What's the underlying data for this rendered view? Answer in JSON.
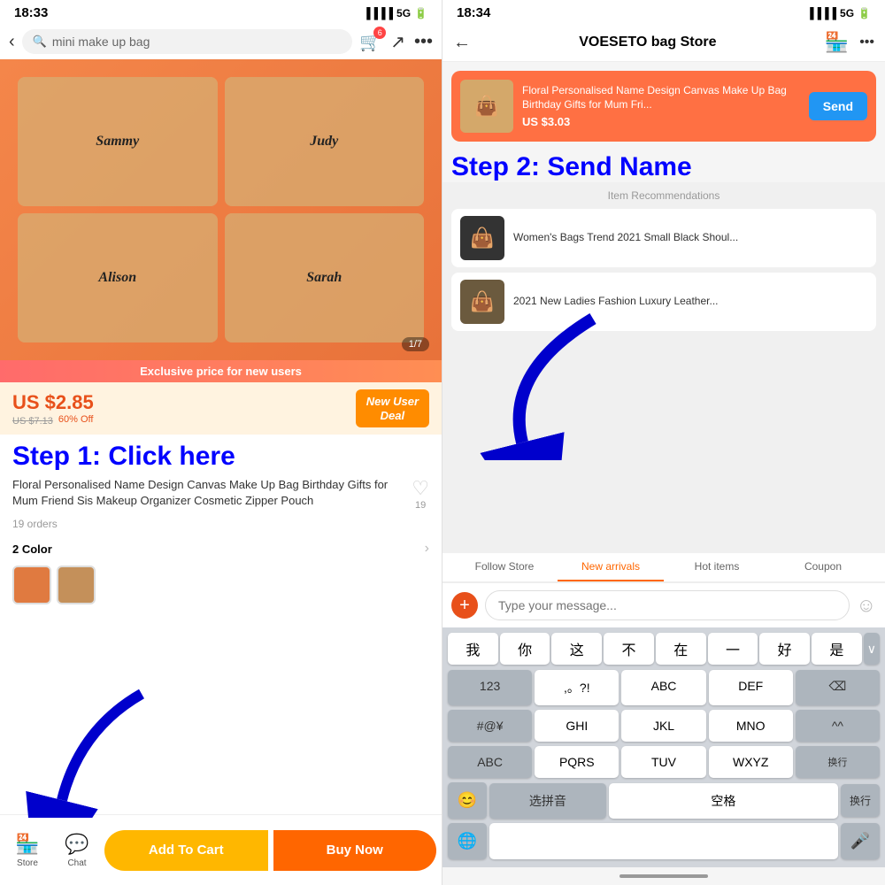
{
  "left": {
    "statusBar": {
      "time": "18:33",
      "network": "5G"
    },
    "searchPlaceholder": "mini make up bag",
    "cartCount": "6",
    "imageCounter": "1/7",
    "exclusiveBanner": "Exclusive price for new users",
    "price": {
      "current": "US $2.85",
      "original": "US $7.13",
      "discount": "60% Off"
    },
    "newUserDeal": "New User\nDeal",
    "step1Label": "Step 1: Click here",
    "productTitle": "Floral Personalised Name Design Canvas Make Up Bag Birthday Gifts for Mum Friend Sis Makeup Organizer Cosmetic Zipper Pouch",
    "wishlistCount": "19",
    "ordersCount": "19 orders",
    "colorSection": {
      "label": "2 Color"
    },
    "bottomNav": {
      "storeLabel": "Store",
      "chatLabel": "Chat",
      "addToCart": "Add To Cart",
      "buyNow": "Buy Now"
    },
    "bagNames": [
      "Sammy",
      "Judy",
      "Alison",
      "Sarah"
    ]
  },
  "right": {
    "statusBar": {
      "time": "18:34",
      "network": "5G"
    },
    "storeTitle": "VOESETO bag Store",
    "chatProduct": {
      "title": "Floral Personalised Name Design Canvas Make Up Bag Birthday Gifts for Mum Fri...",
      "price": "US $3.03",
      "sendLabel": "Send"
    },
    "step2Label": "Step 2: Send Name",
    "itemRecsLabel": "Item Recommendations",
    "recItems": [
      {
        "title": "Women's Bags Trend 2021 Small Black Shoul...",
        "emoji": "👜"
      },
      {
        "title": "2021 New Ladies Fashion Luxury Leather...",
        "emoji": "👜"
      }
    ],
    "tabs": [
      "Follow Store",
      "New arrivals",
      "Hot items",
      "Coupon"
    ],
    "activeTab": "New arrivals",
    "messagePlaceholder": "Type your message...",
    "keyboard": {
      "quickChars": [
        "我",
        "你",
        "这",
        "不",
        "在",
        "一",
        "好",
        "是"
      ],
      "rows": [
        [
          "123",
          ",。?!",
          "ABC",
          "DEF",
          "⌫"
        ],
        [
          "#@¥",
          "GHI",
          "JKL",
          "MNO",
          "^^"
        ],
        [
          "ABC",
          "PQRS",
          "TUV",
          "WXYZ",
          "换行"
        ],
        [
          "😊",
          "选拼音",
          "空格",
          "换行"
        ]
      ]
    }
  }
}
